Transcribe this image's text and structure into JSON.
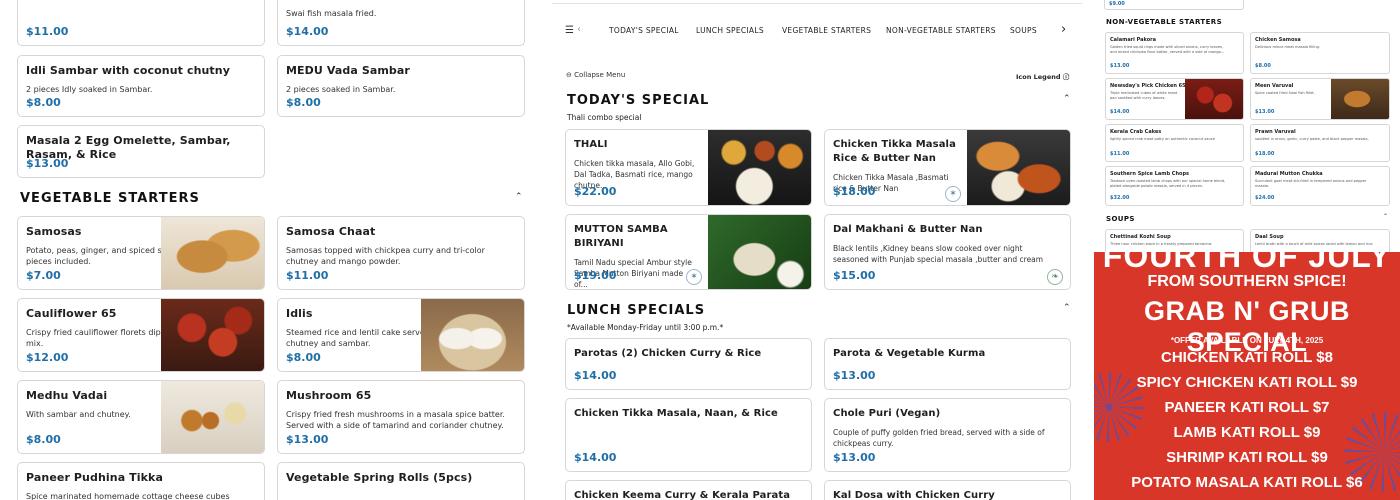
{
  "left": {
    "top_cards": [
      {
        "name": "",
        "desc": "",
        "price": "$11.00"
      },
      {
        "name": "",
        "desc": "Swai fish masala fried.",
        "price": "$14.00"
      },
      {
        "name": "Idli Sambar with coconut chutny",
        "desc": "2 pieces Idly soaked in Sambar.",
        "price": "$8.00"
      },
      {
        "name": "MEDU Vada Sambar",
        "desc": "2 pieces soaked in Sambar.",
        "price": "$8.00"
      },
      {
        "name": "Masala 2 Egg Omelette, Sambar, Rasam, & Rice",
        "desc": "",
        "price": "$13.00"
      }
    ],
    "veg_title": "VEGETABLE STARTERS",
    "veg_cards": [
      {
        "name": "Samosas",
        "desc": "Potato, peas, ginger, and spiced stuffed turnover. 2 pieces included.",
        "price": "$7.00"
      },
      {
        "name": "Samosa Chaat",
        "desc": "Samosas topped with chickpea curry and tri-color chutney and mango powder.",
        "price": "$11.00"
      },
      {
        "name": "Cauliflower 65",
        "desc": "Crispy fried cauliflower florets dipped with spice flour mix.",
        "price": "$12.00"
      },
      {
        "name": "Idlis",
        "desc": "Steamed rice and lentil cake served with coconut chutney and sambar.",
        "price": "$8.00"
      },
      {
        "name": "Medhu Vadai",
        "desc": "With sambar and chutney.",
        "price": "$8.00"
      },
      {
        "name": "Mushroom 65",
        "desc": "Crispy fried fresh mushrooms in a masala spice batter. Served with a side of tamarind and coriander chutney.",
        "price": "$13.00"
      },
      {
        "name": "Paneer Pudhina Tikka",
        "desc": "Spice marinated homemade cottage cheese cubes roasted in tandoori oven.",
        "price": ""
      },
      {
        "name": "Vegetable Spring Rolls (5pcs)",
        "desc": "",
        "price": ""
      }
    ]
  },
  "middle": {
    "tabs": [
      "TODAY'S SPECIAL",
      "LUNCH SPECIALS",
      "VEGETABLE STARTERS",
      "NON-VEGETABLE STARTERS",
      "SOUPS"
    ],
    "collapse_label": "Collapse Menu",
    "legend_label": "Icon Legend",
    "special_title": "TODAY'S SPECIAL",
    "special_sub": "Thali combo special",
    "special_cards": [
      {
        "name": "THALI",
        "desc": "Chicken tikka masala, Allo Gobi, Dal Tadka, Basmati rice, mango chutne...",
        "price": "$22.00"
      },
      {
        "name": "Chicken Tikka Masala Rice & Butter Nan",
        "desc": "Chicken Tikka Masala ,Basmati rice & Butter Nan",
        "price": "$18.00"
      },
      {
        "name": "MUTTON SAMBA BIRIYANI",
        "desc": "Tamil Nadu special Ambur style Samba Mutton Biriyani made of...",
        "price": "$19.00"
      },
      {
        "name": "Dal Makhani & Butter Nan",
        "desc": "Black lentils ,Kidney beans slow cooked over night seasoned with Punjab special masala ,butter and cream",
        "price": "$15.00"
      }
    ],
    "lunch_title": "LUNCH SPECIALS",
    "lunch_sub": "*Available Monday-Friday until 3:00 p.m.*",
    "lunch_cards": [
      {
        "name": "Parotas (2) Chicken Curry & Rice",
        "desc": "",
        "price": "$14.00"
      },
      {
        "name": "Parota & Vegetable Kurma",
        "desc": "",
        "price": "$13.00"
      },
      {
        "name": "Chicken Tikka Masala, Naan, & Rice",
        "desc": "",
        "price": "$14.00"
      },
      {
        "name": "Chole Puri (Vegan)",
        "desc": "Couple of puffy golden fried bread, served with a side of chickpeas curry.",
        "price": "$13.00"
      },
      {
        "name": "Chicken Keema Curry & Kerala Parata Bread",
        "desc": "",
        "price": ""
      },
      {
        "name": "Kal Dosa with Chicken Curry",
        "desc": "",
        "price": ""
      }
    ]
  },
  "right": {
    "top_price": "$9.00",
    "nonveg_title": "NON-VEGETABLE STARTERS",
    "nonveg_cards": [
      {
        "name": "Calamari Pakora",
        "desc": "Golden fried squid rings made with sliced onions, curry leaves, and mixed chickpea flour batter, served with a side of mango...",
        "price": "$13.00"
      },
      {
        "name": "Chicken Samosa",
        "desc": "Delicious mince meat masala filling.",
        "price": "$8.00"
      },
      {
        "name": "Newsday's Pick Chicken 65",
        "desc": "Triple marinated cubes of white meat pan sautéed with curry leaves.",
        "price": "$14.00"
      },
      {
        "name": "Meen Varuval",
        "desc": "Spice coated fried Swai fish fillet.",
        "price": "$13.00"
      },
      {
        "name": "Kerala Crab Cakes",
        "desc": "lightly spiced crab meat patty on authentic coconut sauce",
        "price": "$11.00"
      },
      {
        "name": "Prawn Varuval",
        "desc": "sautéed in onion, garlic, curry paste, and black pepper masala.",
        "price": "$18.00"
      },
      {
        "name": "Southern Spice Lamb Chops",
        "desc": "Tandoori oven-roasted lamb chops with our special home blend, plated alongside potato masala, served in 4 pieces.",
        "price": "$32.00"
      },
      {
        "name": "Madurai Mutton Chukka",
        "desc": "Succulent goat meat stir-fried in tempered onions and pepper masala.",
        "price": "$24.00"
      }
    ],
    "soups_title": "SOUPS",
    "soup_cards": [
      {
        "name": "Chettinad Kozhi Soup",
        "desc": "Three hour chicken stock in a freshly prepared tamarind."
      },
      {
        "name": "Daal Soup",
        "desc": "Lentil broth with a touch of mild spices laced with lemon and rice."
      }
    ]
  },
  "promo": {
    "title": "FOURTH OF JULY",
    "subtitle": "FROM SOUTHERN SPICE!",
    "headline": "GRAB N' GRUB SPECIAL",
    "offer_note": "*OFFER AVAILABLE ON JULY 4TH, 2025",
    "items": [
      "CHICKEN KATI ROLL $8",
      "SPICY CHICKEN KATI ROLL $9",
      "PANEER KATI ROLL $7",
      "LAMB KATI ROLL $9",
      "SHRIMP KATI ROLL $9",
      "POTATO MASALA KATI ROLL $6"
    ]
  },
  "colors": {
    "price": "#1f6fa7",
    "promo_bg": "#d9362a"
  }
}
